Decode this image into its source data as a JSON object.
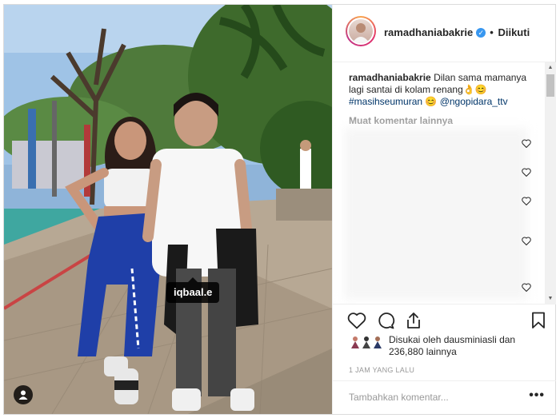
{
  "post": {
    "username": "ramadhaniabakrie",
    "verified": true,
    "follow_separator": "•",
    "follow_state": "Diikuti",
    "photo_tag": "iqbaal.e"
  },
  "caption": {
    "username": "ramadhaniabakrie",
    "text": "Dilan sama mamanya lagi santai di kolam renang👌😊",
    "hashtag": "#masihseumuran",
    "emoji_after_hashtag": "😊",
    "mention": "@ngopidara_ttv"
  },
  "comments": {
    "load_more_label": "Muat komentar lainnya"
  },
  "likes": {
    "line1": "Disukai oleh dausminiasli dan",
    "line2": "236,880 lainnya"
  },
  "timestamp": "1 JAM YANG LALU",
  "add_comment": {
    "placeholder": "Tambahkan komentar...",
    "more_label": "•••"
  },
  "scrollbar": {
    "up_arrow": "▲",
    "down_arrow": "▼"
  },
  "icons": {
    "like": "heart-icon",
    "comment": "comment-icon",
    "share": "share-icon",
    "save": "bookmark-icon",
    "verified": "verified-badge-icon",
    "user_tag": "user-tag-icon",
    "comment_like": "heart-icon"
  },
  "colors": {
    "link": "#003569",
    "verified": "#3897f0",
    "muted": "#999999",
    "border": "#efefef"
  }
}
